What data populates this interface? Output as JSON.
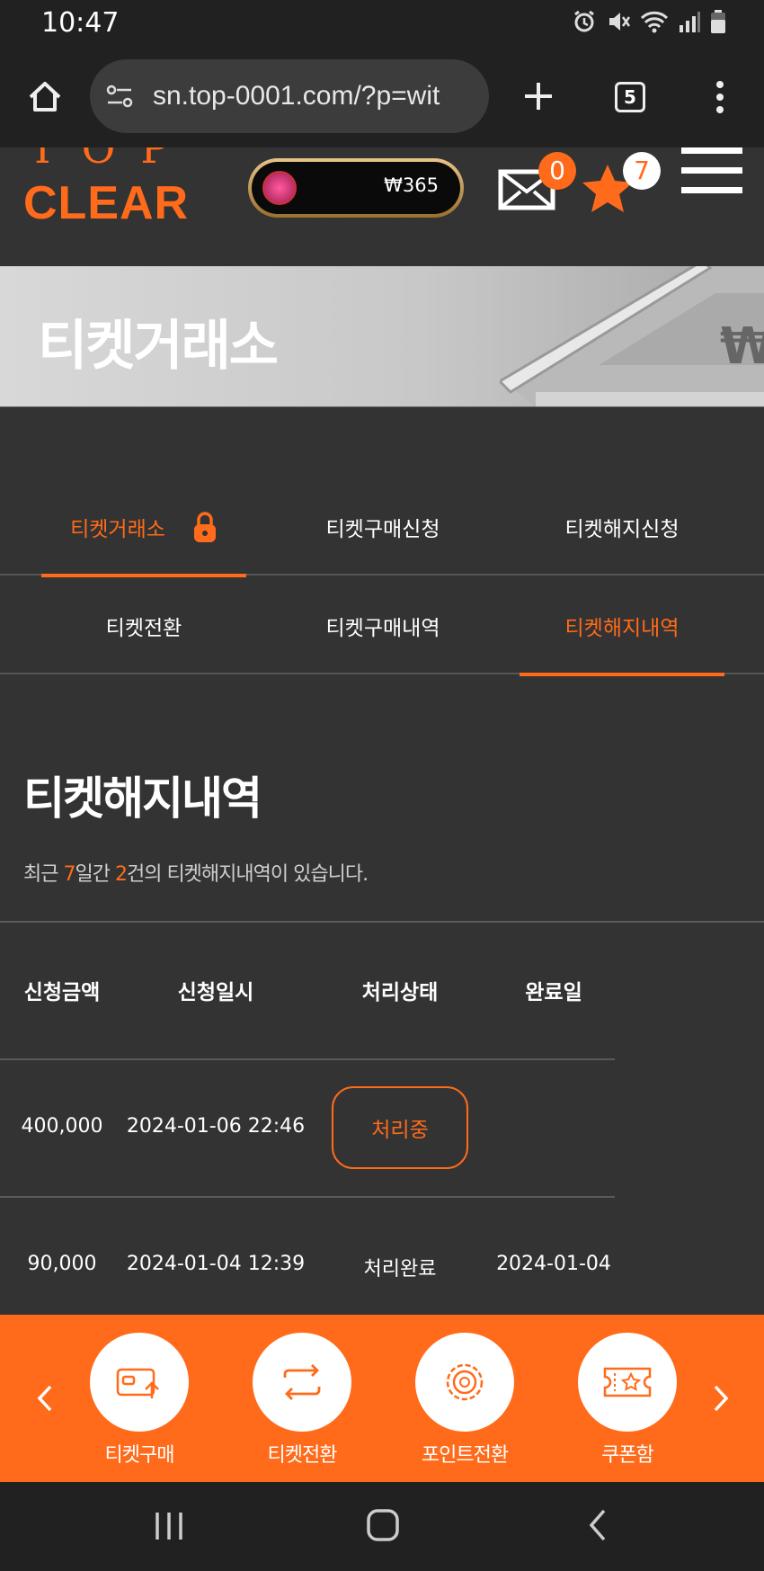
{
  "status_bar": {
    "time": "10:47"
  },
  "browser": {
    "url": "sn.top-0001.com/?p=wit",
    "tab_count": "5"
  },
  "header": {
    "logo_top": "TOP",
    "logo_bottom": "CLEAR",
    "balance": "₩365",
    "mail_count": "0",
    "star_count": "7",
    "colors": {
      "accent": "#ff6b1a",
      "badge_text": "#ff6b1a"
    }
  },
  "banner": {
    "title": "티켓거래소"
  },
  "nav": {
    "row1": [
      {
        "label": "티켓거래소",
        "active": true
      },
      {
        "label": "티켓구매신청",
        "active": false
      },
      {
        "label": "티켓해지신청",
        "active": false
      }
    ],
    "row2": [
      {
        "label": "티켓전환",
        "active": false
      },
      {
        "label": "티켓구매내역",
        "active": false
      },
      {
        "label": "티켓해지내역",
        "active": true
      }
    ]
  },
  "section": {
    "title": "티켓해지내역",
    "summary_prefix": "최근 ",
    "summary_days": "7",
    "summary_mid": "일간 ",
    "summary_count": "2",
    "summary_suffix": "건의 티켓해지내역이 있습니다."
  },
  "table": {
    "headers": [
      "신청금액",
      "신청일시",
      "처리상태",
      "완료일"
    ],
    "rows": [
      {
        "amount": "400,000",
        "requested": "2024-01-06 22:46",
        "status": "처리중",
        "completed": ""
      },
      {
        "amount": "90,000",
        "requested": "2024-01-04 12:39",
        "status": "처리완료",
        "completed": "2024-01-04"
      }
    ]
  },
  "quick_menu": [
    {
      "label": "티켓구매",
      "icon": "wallet-upload-icon"
    },
    {
      "label": "티켓전환",
      "icon": "swap-icon"
    },
    {
      "label": "포인트전환",
      "icon": "coin-icon"
    },
    {
      "label": "쿠폰함",
      "icon": "coupon-icon"
    }
  ]
}
